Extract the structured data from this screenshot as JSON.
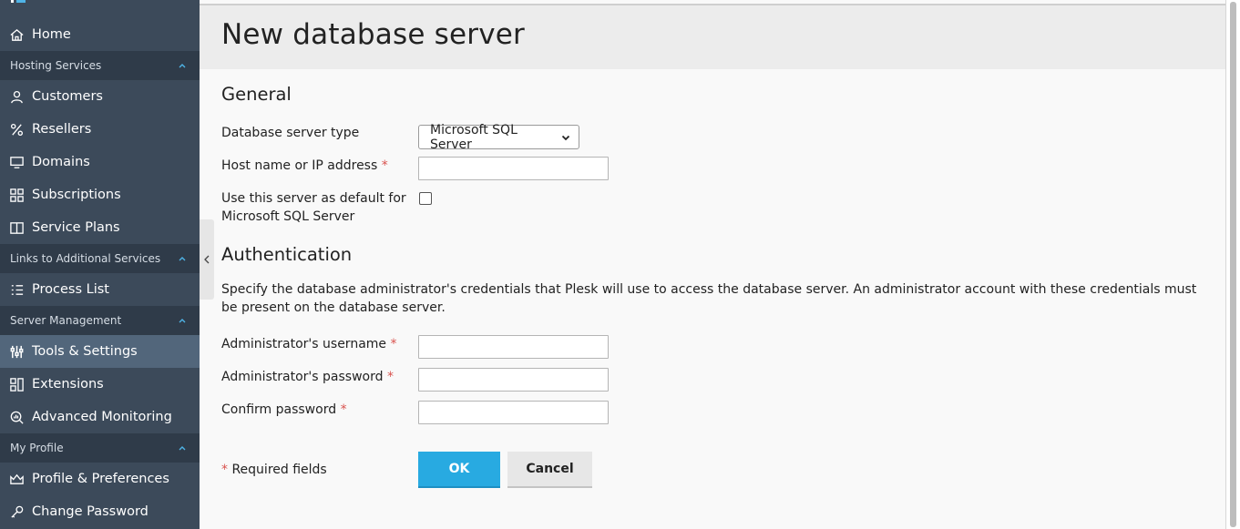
{
  "sidebar": {
    "home": "Home",
    "groups": {
      "hosting": "Hosting Services",
      "links": "Links to Additional Services",
      "server": "Server Management",
      "profile": "My Profile"
    },
    "items": {
      "customers": "Customers",
      "resellers": "Resellers",
      "domains": "Domains",
      "subscriptions": "Subscriptions",
      "service_plans": "Service Plans",
      "process_list": "Process List",
      "tools_settings": "Tools & Settings",
      "extensions": "Extensions",
      "advanced_monitoring": "Advanced Monitoring",
      "profile_preferences": "Profile & Preferences",
      "change_password": "Change Password"
    },
    "active_item": "Tools & Settings"
  },
  "page": {
    "title": "New database server"
  },
  "general": {
    "title": "General",
    "db_type_label": "Database server type",
    "db_type_value": "Microsoft SQL Server",
    "host_label": "Host name or IP address",
    "host_value": "",
    "default_label_line1": "Use this server as default for",
    "default_label_line2": "Microsoft SQL Server",
    "default_checked": false
  },
  "auth": {
    "title": "Authentication",
    "description": "Specify the database administrator's credentials that Plesk will use to access the database server. An administrator account with these credentials must be present on the database server.",
    "username_label": "Administrator's username",
    "password_label": "Administrator's password",
    "confirm_label": "Confirm password",
    "username_value": "",
    "password_value": "",
    "confirm_value": ""
  },
  "form": {
    "required_marker": "*",
    "required_note": "Required fields",
    "ok_label": "OK",
    "cancel_label": "Cancel"
  },
  "colors": {
    "sidebar_bg": "#3c4a5a",
    "group_bg": "#2f3b49",
    "active_bg": "#52667b",
    "accent": "#28aae1",
    "required": "#d9534f"
  }
}
